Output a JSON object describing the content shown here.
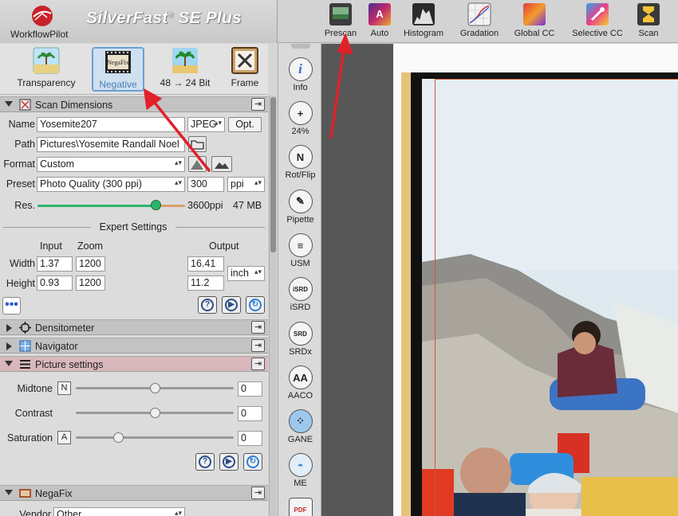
{
  "app": {
    "brand_label": "WorkflowPilot",
    "title": "SilverFast",
    "title_mark": "®",
    "title_suffix": "SE Plus"
  },
  "toolbar": [
    {
      "name": "prescan",
      "label": "Prescan",
      "icon": "prescan-icon"
    },
    {
      "name": "auto",
      "label": "Auto",
      "icon": "auto-icon"
    },
    {
      "name": "histogram",
      "label": "Histogram",
      "icon": "histogram-icon"
    },
    {
      "name": "gradation",
      "label": "Gradation",
      "icon": "gradation-icon"
    },
    {
      "name": "global-cc",
      "label": "Global CC",
      "icon": "global-cc-icon"
    },
    {
      "name": "selective-cc",
      "label": "Selective CC",
      "icon": "selective-cc-icon"
    },
    {
      "name": "scan",
      "label": "Scan",
      "icon": "scan-icon"
    }
  ],
  "modes": [
    {
      "label": "Transparency",
      "icon": "transparency-icon",
      "selected": false
    },
    {
      "label": "Negative",
      "icon": "negafix-icon",
      "selected": true,
      "icon_text": "NegaFix"
    },
    {
      "label": "48 → 24 Bit",
      "icon": "palm-icon",
      "selected": false
    },
    {
      "label": "Frame",
      "icon": "frame-tools-icon",
      "selected": false
    }
  ],
  "scan_dimensions": {
    "title": "Scan Dimensions",
    "name_label": "Name",
    "name_value": "Yosemite207",
    "format_value": "JPEG",
    "opt_label": "Opt.",
    "path_label": "Path",
    "path_value": "Pictures\\Yosemite Randall Noel",
    "format_label": "Format",
    "format_select": "Custom",
    "preset_label": "Preset",
    "preset_value": "Photo Quality (300 ppi)",
    "preset_ppi": "300",
    "ppi_unit": "ppi",
    "res_label": "Res.",
    "res_value": "3600ppi",
    "file_size": "47 MB",
    "res_level": 0.8,
    "expert_title": "Expert Settings",
    "input_label": "Input",
    "zoom_label": "Zoom",
    "output_label": "Output",
    "width_label": "Width",
    "width_input": "1.37",
    "width_zoom": "1200",
    "width_output": "16.41",
    "height_label": "Height",
    "height_input": "0.93",
    "height_zoom": "1200",
    "height_output": "11.2",
    "unit": "inch"
  },
  "sections": {
    "densitometer": "Densitometer",
    "navigator": "Navigator",
    "picture_settings": "Picture settings",
    "negafix": "NegaFix"
  },
  "picture_settings": {
    "midtone_label": "Midtone",
    "midtone_key": "N",
    "midtone_value": "0",
    "midtone_level": 0.5,
    "contrast_label": "Contrast",
    "contrast_value": "0",
    "contrast_level": 0.5,
    "saturation_label": "Saturation",
    "saturation_key": "A",
    "saturation_value": "0",
    "saturation_level": 0.27
  },
  "negafix": {
    "vendor_label": "Vendor",
    "vendor_value": "Other"
  },
  "side_tools": [
    {
      "label": "Info",
      "icon": "info-icon",
      "glyph": "i"
    },
    {
      "label": "24%",
      "icon": "zoom-icon",
      "glyph": "+"
    },
    {
      "label": "Rot/Flip",
      "icon": "rotate-flip-icon",
      "glyph": "N"
    },
    {
      "label": "Pipette",
      "icon": "pipette-icon",
      "glyph": "✎"
    },
    {
      "label": "USM",
      "icon": "usm-icon",
      "glyph": "≡"
    },
    {
      "label": "iSRD",
      "icon": "isrd-icon",
      "glyph": "iSRD"
    },
    {
      "label": "SRDx",
      "icon": "srdx-icon",
      "glyph": "SRD"
    },
    {
      "label": "AACO",
      "icon": "aaco-icon",
      "glyph": "AA"
    },
    {
      "label": "GANE",
      "icon": "gane-icon",
      "glyph": "⁘"
    },
    {
      "label": "ME",
      "icon": "me-icon",
      "glyph": "◓"
    },
    {
      "label": "",
      "icon": "pdf-icon",
      "glyph": "PDF"
    }
  ],
  "colors": {
    "accent_blue": "#6aa0d8",
    "pink_header": "#d9b8bd",
    "slider_green": "#2db36b",
    "annotation_red": "#e0202a"
  }
}
